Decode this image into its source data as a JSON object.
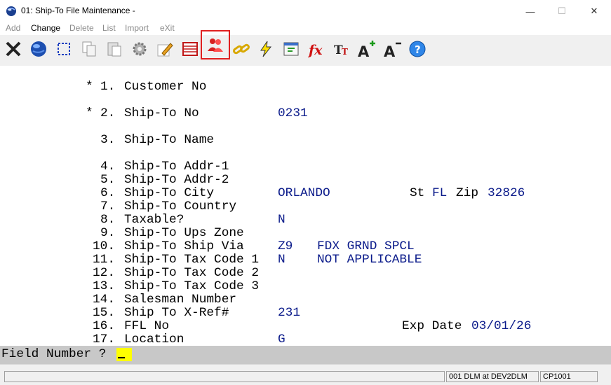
{
  "window": {
    "title": "01: Ship-To File Maintenance -",
    "minimize_glyph": "—",
    "maximize_glyph": "☐",
    "close_glyph": "✕"
  },
  "menu": [
    {
      "label": "Add",
      "enabled": false
    },
    {
      "label": "Change",
      "enabled": true
    },
    {
      "label": "Delete",
      "enabled": false
    },
    {
      "label": "List",
      "enabled": false
    },
    {
      "label": "Import",
      "enabled": false
    },
    {
      "label": "eXit",
      "enabled": false
    }
  ],
  "toolbar": [
    {
      "icon": "close-icon"
    },
    {
      "icon": "globe-icon"
    },
    {
      "icon": "select-icon"
    },
    {
      "icon": "copy-icon"
    },
    {
      "icon": "paste-icon"
    },
    {
      "icon": "gear-icon"
    },
    {
      "icon": "edit-icon"
    },
    {
      "icon": "table-icon"
    },
    {
      "icon": "users-icon",
      "selected": true
    },
    {
      "icon": "link-icon"
    },
    {
      "icon": "lightning-icon"
    },
    {
      "icon": "run-icon"
    },
    {
      "icon": "function-icon"
    },
    {
      "icon": "font-icon"
    },
    {
      "icon": "font-increase-icon"
    },
    {
      "icon": "font-decrease-icon"
    },
    {
      "icon": "help-icon"
    }
  ],
  "fields": [
    {
      "marker": "*",
      "number": "1.",
      "label": "Customer No",
      "value": ""
    },
    {
      "marker": "*",
      "number": "2.",
      "label": "Ship-To No",
      "value": "0231"
    },
    {
      "marker": "",
      "number": "3.",
      "label": "Ship-To Name",
      "value": ""
    },
    {
      "marker": "",
      "number": "4.",
      "label": "Ship-To Addr-1",
      "value": ""
    },
    {
      "marker": "",
      "number": "5.",
      "label": "Ship-To Addr-2",
      "value": ""
    },
    {
      "marker": "",
      "number": "6.",
      "label": "Ship-To City",
      "value": "ORLANDO"
    },
    {
      "marker": "",
      "number": "7.",
      "label": "Ship-To Country",
      "value": ""
    },
    {
      "marker": "",
      "number": "8.",
      "label": "Taxable?",
      "value": "N"
    },
    {
      "marker": "",
      "number": "9.",
      "label": "Ship-To Ups Zone",
      "value": ""
    },
    {
      "marker": "",
      "number": "10.",
      "label": "Ship-To Ship Via",
      "value": "Z9",
      "desc": "FDX GRND SPCL"
    },
    {
      "marker": "",
      "number": "11.",
      "label": "Ship-To Tax Code 1",
      "value": "N",
      "desc": "NOT APPLICABLE"
    },
    {
      "marker": "",
      "number": "12.",
      "label": "Ship-To Tax Code 2",
      "value": ""
    },
    {
      "marker": "",
      "number": "13.",
      "label": "Ship-To Tax Code 3",
      "value": ""
    },
    {
      "marker": "",
      "number": "14.",
      "label": "Salesman Number",
      "value": ""
    },
    {
      "marker": "",
      "number": "15.",
      "label": "Ship To X-Ref#",
      "value": "231"
    },
    {
      "marker": "",
      "number": "16.",
      "label": "FFL No",
      "value": ""
    },
    {
      "marker": "",
      "number": "17.",
      "label": "Location",
      "value": "G"
    }
  ],
  "city_extra": {
    "st_label": "St",
    "st_value": "FL",
    "zip_label": "Zip",
    "zip_value": "32826"
  },
  "ffl_extra": {
    "exp_label": "Exp Date",
    "exp_value": "03/01/26"
  },
  "prompt": {
    "text": "Field Number ?",
    "input_value": ""
  },
  "status": {
    "pane1": "",
    "pane2": "001 DLM at DEV2DLM",
    "pane3": "CP1001"
  }
}
